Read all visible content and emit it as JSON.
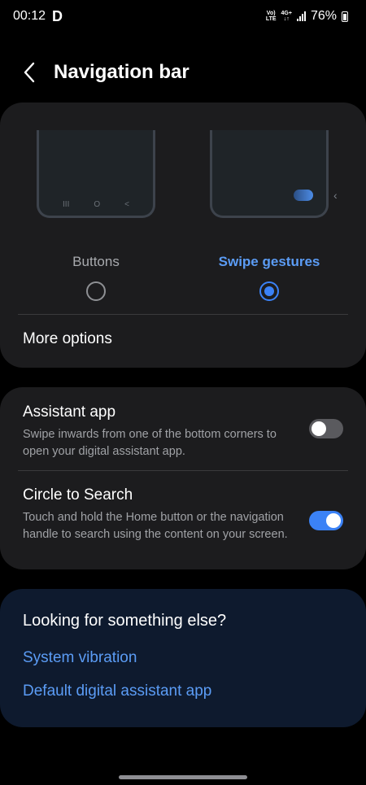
{
  "status_bar": {
    "time": "00:12",
    "carrier_badge": "D",
    "volte_top": "Vo)",
    "volte_bottom": "LTE",
    "network_top": "4G+",
    "network_bottom": "↓↑",
    "battery": "76%"
  },
  "header": {
    "title": "Navigation bar",
    "back_icon": "chevron-left-icon"
  },
  "nav_type_card": {
    "options": [
      {
        "label": "Buttons",
        "selected": false
      },
      {
        "label": "Swipe gestures",
        "selected": true
      }
    ],
    "button_preview_icons": [
      "III",
      "O",
      "<"
    ],
    "swipe_side_chevron": "‹",
    "more_options_label": "More options",
    "accent_color": "#3b82f6"
  },
  "gesture_settings_card": {
    "items": [
      {
        "title": "Assistant app",
        "description": "Swipe inwards from one of the bottom corners to open your digital assistant app.",
        "enabled": false
      },
      {
        "title": "Circle to Search",
        "description": "Touch and hold the Home button or the navigation handle to search using the content on your screen.",
        "enabled": true
      }
    ]
  },
  "suggestions_card": {
    "title": "Looking for something else?",
    "links": [
      "System vibration",
      "Default digital assistant app"
    ]
  }
}
